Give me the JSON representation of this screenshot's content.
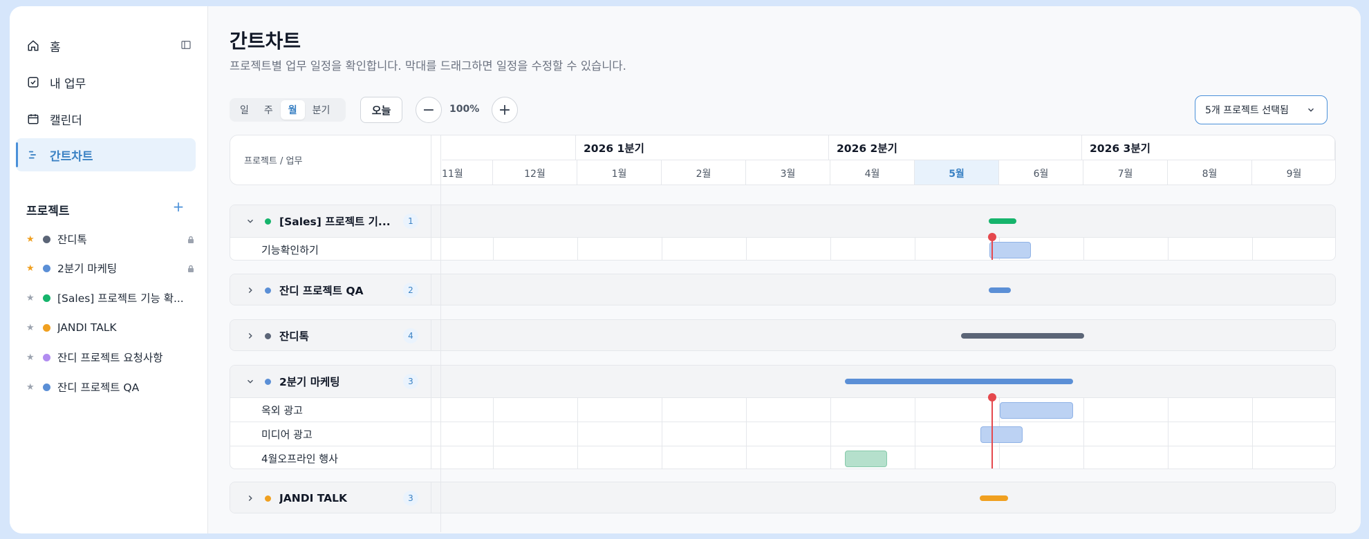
{
  "nav": {
    "home": "홈",
    "mytasks": "내 업무",
    "calendar": "캘린더",
    "gantt": "간트차트"
  },
  "projects": {
    "header": "프로젝트",
    "add": "+",
    "items": [
      {
        "label": "잔디톡",
        "starred": true,
        "dot": "#5b6577",
        "locked": true
      },
      {
        "label": "2분기 마케팅",
        "starred": true,
        "dot": "#5b8fd6",
        "locked": true
      },
      {
        "label": "[Sales] 프로젝트 기능 확...",
        "starred": false,
        "dot": "#16b46c",
        "locked": false
      },
      {
        "label": "JANDI TALK",
        "starred": false,
        "dot": "#f0a020",
        "locked": false
      },
      {
        "label": "잔디 프로젝트 요청사항",
        "starred": false,
        "dot": "#b18cf0",
        "locked": false
      },
      {
        "label": "잔디 프로젝트 QA",
        "starred": false,
        "dot": "#5b8fd6",
        "locked": false
      }
    ]
  },
  "page": {
    "title": "간트차트",
    "subtitle": "프로젝트별 업무 일정을 확인합니다. 막대를 드래그하면 일정을 수정할 수 있습니다."
  },
  "toolbar": {
    "views": [
      "일",
      "주",
      "월",
      "분기"
    ],
    "active_view": "월",
    "today": "오늘",
    "zoom": "100%",
    "zoom_out": "−",
    "zoom_in": "+",
    "project_select": "5개 프로젝트 선택됨"
  },
  "gantt": {
    "left_header": "프로젝트 / 업무",
    "quarters": [
      "2026 1분기",
      "2026 2분기",
      "2026 3분기"
    ],
    "months": [
      "11월",
      "12월",
      "1월",
      "2월",
      "3월",
      "4월",
      "5월",
      "6월",
      "7월",
      "8월",
      "9월"
    ],
    "current_month": "5월",
    "groups": [
      {
        "name": "[Sales] 프로젝트 기...",
        "count": "1",
        "dot": "#16b46c",
        "expanded": true,
        "tasks": [
          "기능확인하기"
        ]
      },
      {
        "name": "잔디 프로젝트 QA",
        "count": "2",
        "dot": "#5b8fd6",
        "expanded": false,
        "tasks": []
      },
      {
        "name": "잔디톡",
        "count": "4",
        "dot": "#5b6577",
        "expanded": false,
        "tasks": []
      },
      {
        "name": "2분기 마케팅",
        "count": "3",
        "dot": "#5b8fd6",
        "expanded": true,
        "tasks": [
          "옥외 광고",
          "미디어 광고",
          "4월오프라인 행사"
        ]
      },
      {
        "name": "JANDI TALK",
        "count": "3",
        "dot": "#f0a020",
        "expanded": false,
        "tasks": []
      }
    ]
  },
  "colors": {
    "accent": "#4a90d9",
    "today": "#e5484d",
    "task_blue_fill": "#bcd2f3",
    "task_blue_border": "#8fb2e6",
    "task_green_fill": "#b5e0cc",
    "task_green_border": "#86c9aa"
  }
}
